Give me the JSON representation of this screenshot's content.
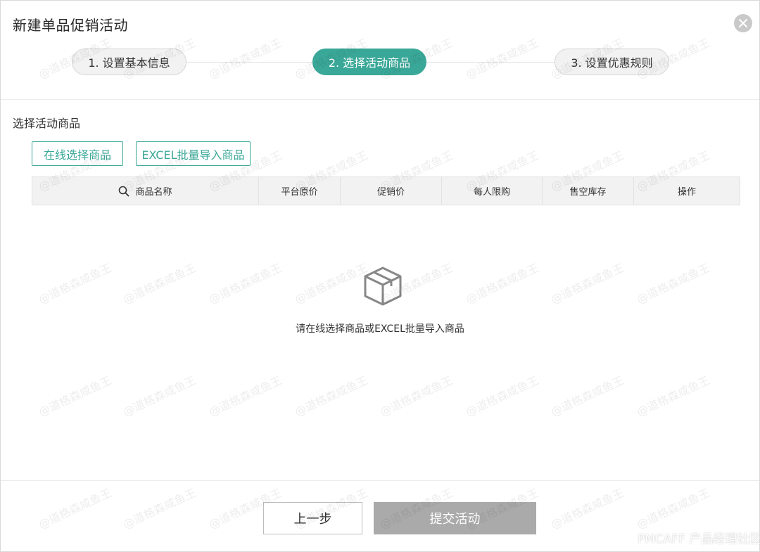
{
  "dialog": {
    "title": "新建单品促销活动",
    "close_icon": "close-icon"
  },
  "steps": [
    {
      "label": "1. 设置基本信息",
      "state": "inactive"
    },
    {
      "label": "2. 选择活动商品",
      "state": "active"
    },
    {
      "label": "3. 设置优惠规则",
      "state": "inactive"
    }
  ],
  "section": {
    "title": "选择活动商品",
    "online_select_label": "在线选择商品",
    "excel_import_label": "EXCEL批量导入商品"
  },
  "table": {
    "search_icon": "search-icon",
    "columns": [
      "商品名称",
      "平台原价",
      "促销价",
      "每人限购",
      "售空库存",
      "操作"
    ]
  },
  "empty_state": {
    "icon": "box-icon",
    "text": "请在线选择商品或EXCEL批量导入商品"
  },
  "footer": {
    "prev_label": "上一步",
    "submit_label": "提交活动"
  },
  "watermark": {
    "text": "@道格森咸鱼王",
    "brand": "PMCAFF 产品经理社区"
  },
  "colors": {
    "accent": "#3aa898",
    "disabled": "#aaaaaa"
  }
}
